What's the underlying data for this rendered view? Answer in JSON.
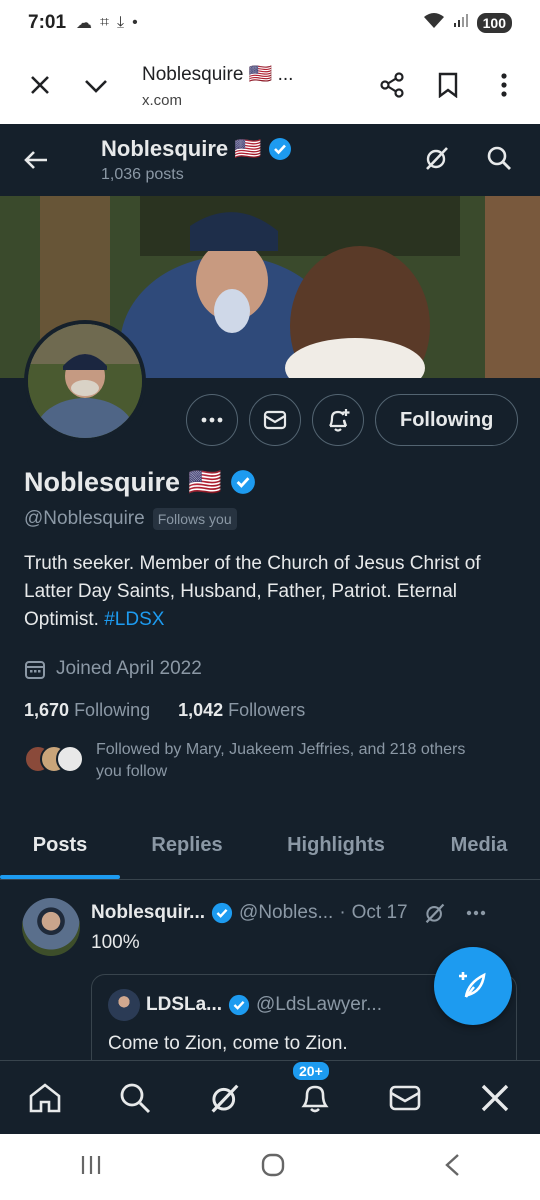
{
  "status_bar": {
    "time": "7:01",
    "battery": "100"
  },
  "browser": {
    "tab_title": "Noblesquire 🇺🇸 ...",
    "url": "x.com"
  },
  "header": {
    "name": "Noblesquire",
    "flag": "🇺🇸",
    "posts_count": "1,036 posts"
  },
  "profile": {
    "name": "Noblesquire",
    "flag": "🇺🇸",
    "handle": "@Noblesquire",
    "follows_you": "Follows you",
    "bio_text": "Truth seeker. Member of the Church of Jesus Christ of Latter Day Saints, Husband, Father, Patriot. Eternal Optimist.",
    "bio_hashtag": "#LDSX",
    "joined": "Joined April 2022",
    "following_count": "1,670",
    "following_label": "Following",
    "followers_count": "1,042",
    "followers_label": "Followers",
    "followed_by": "Followed by Mary, Juakeem Jeffries, and 218 others you follow",
    "following_button": "Following"
  },
  "tabs": [
    {
      "label": "Posts",
      "active": true
    },
    {
      "label": "Replies",
      "active": false
    },
    {
      "label": "Highlights",
      "active": false
    },
    {
      "label": "Media",
      "active": false
    }
  ],
  "post": {
    "author": "Noblesquir...",
    "handle": "@Nobles...",
    "separator": "·",
    "date": "Oct 17",
    "text": "100%",
    "quote": {
      "author": "LDSLa...",
      "handle": "@LdsLawyer...",
      "text": "Come to Zion, come to Zion."
    }
  },
  "bottom_nav": {
    "notifications_badge": "20+"
  },
  "colors": {
    "background": "#15202b",
    "accent": "#1d9bf0",
    "muted_text": "#8b98a5",
    "border": "#38444d"
  }
}
